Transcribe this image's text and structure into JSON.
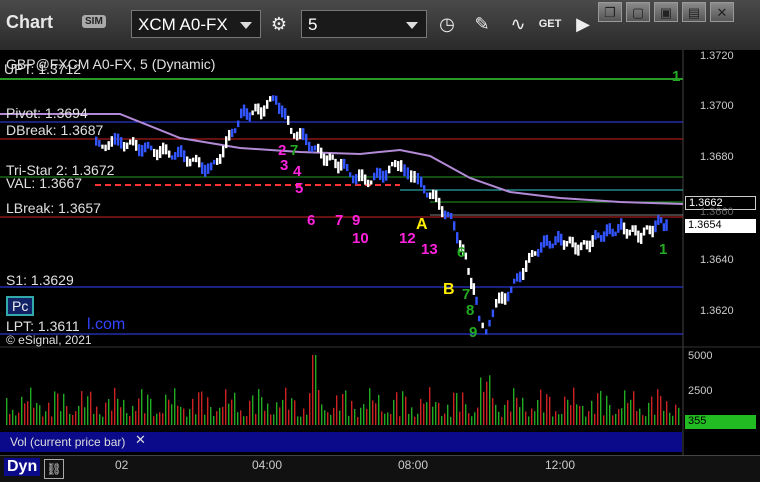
{
  "toolbar": {
    "title": "Chart",
    "sim_badge": "SIM",
    "symbol": "XCM A0-FX",
    "interval": "5",
    "get_label": "GET"
  },
  "window": {
    "restore": "❐",
    "minimize": "▢",
    "maximize": "▣",
    "close": "✕"
  },
  "chart": {
    "legend": "GBP@FXCM A0-FX, 5 (Dynamic)",
    "watermark": "© eSignal, 2021",
    "level_labels": {
      "upt": "UPT: 1.3712",
      "pivot": "Pivot: 1.3694",
      "dbreak": "DBreak: 1.3687",
      "tristar": "Tri-Star 2: 1.3672",
      "val": "VAL: 1.3667",
      "lbreak": "LBreak: 1.3657",
      "s1": "S1: 1.3629",
      "lpt": "LPT: 1.3611"
    },
    "pc_badge": "Pc",
    "com_text": "l.com",
    "price_axis": [
      "1.3720",
      "1.3700",
      "1.3680",
      "1.3640",
      "1.3620"
    ],
    "price_tag_upper": "1.3662",
    "price_tag_lower": "1.3654",
    "price_tag_obscured": "1.3660",
    "right_marker_top": "1",
    "right_marker_bottom": "1",
    "seq_magenta": [
      "2",
      "3",
      "4",
      "5",
      "6",
      "7",
      "9",
      "10",
      "12",
      "13"
    ],
    "seq_green": [
      "7",
      "6",
      "7",
      "8",
      "9"
    ],
    "labels_a_b": [
      "A",
      "B"
    ],
    "vol_label": "Vol (current price bar)",
    "vol_axis": [
      "5000",
      "2500",
      "0"
    ],
    "vol_tag": "355",
    "x_labels": [
      "02",
      "04:00",
      "08:00",
      "12:00"
    ],
    "bottom_label": "Dyn"
  },
  "colors": {
    "candle_up": "#ffffff",
    "candle_down": "#3355ff",
    "magenta": "#ff22dd",
    "green": "#22aa22",
    "yellow": "#ffee00",
    "avg_line": "#b28ad6"
  }
}
